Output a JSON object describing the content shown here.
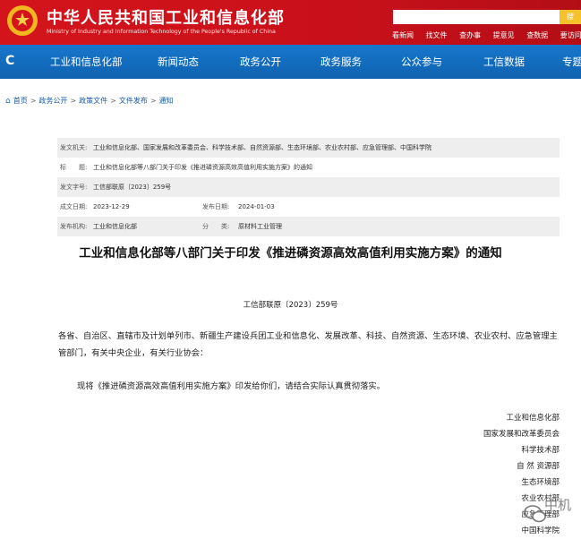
{
  "header": {
    "title": "中华人民共和国工业和信息化部",
    "subtitle": "Ministry of Industry and Information Technology of the People's Republic of China",
    "search_placeholder": "",
    "search_button": "搜",
    "links": [
      "看新闻",
      "找文件",
      "查办事",
      "提意见",
      "查数据",
      "要访问"
    ]
  },
  "nav": {
    "logo_glyph": "C",
    "items": [
      "工业和信息化部",
      "新闻动态",
      "政务公开",
      "政务服务",
      "公众参与",
      "工信数据",
      "专题"
    ]
  },
  "breadcrumb": {
    "items": [
      "首页",
      "政务公开",
      "政策文件",
      "文件发布",
      "通知"
    ],
    "separator": ">"
  },
  "meta": {
    "issuer_label": "发文机关:",
    "issuer": "工业和信息化部、国家发展和改革委员会、科学技术部、自然资源部、生态环境部、农业农村部、应急管理部、中国科学院",
    "title_label": "标　　题:",
    "title": "工业和信息化部等八部门关于印发《推进磷资源高效高值利用实施方案》的通知",
    "doc_no_label": "发文字号:",
    "doc_no": "工信部联原〔2023〕259号",
    "written_label": "成文日期:",
    "written": "2023-12-29",
    "published_label": "发布日期:",
    "published": "2024-01-03",
    "org_label": "发布机构:",
    "org": "工业和信息化部",
    "category_label": "分　　类:",
    "category": "原材料工业管理"
  },
  "article": {
    "title": "工业和信息化部等八部门关于印发《推进磷资源高效高值利用实施方案》的通知",
    "doc_number": "工信部联原〔2023〕259号",
    "para1": "各省、自治区、直辖市及计划单列市、新疆生产建设兵团工业和信息化、发展改革、科技、自然资源、生态环境、农业农村、应急管理主管部门，有关中央企业，有关行业协会：",
    "para2": "现将《推进磷资源高效高值利用实施方案》印发给你们，请结合实际认真贯彻落实。",
    "signers": [
      "工业和信息化部",
      "国家发展和改革委员会",
      "科学技术部",
      "自 然 资源部",
      "生态环境部",
      "农业农村部",
      "应急管理部",
      "中国科学院"
    ]
  },
  "watermark": {
    "text": "中机",
    "icon": "wechat-icon"
  },
  "colors": {
    "header_red": "#d4141b",
    "nav_blue": "#1270c4",
    "link_blue": "#1a5aa6",
    "search_yellow": "#f6c22b"
  }
}
